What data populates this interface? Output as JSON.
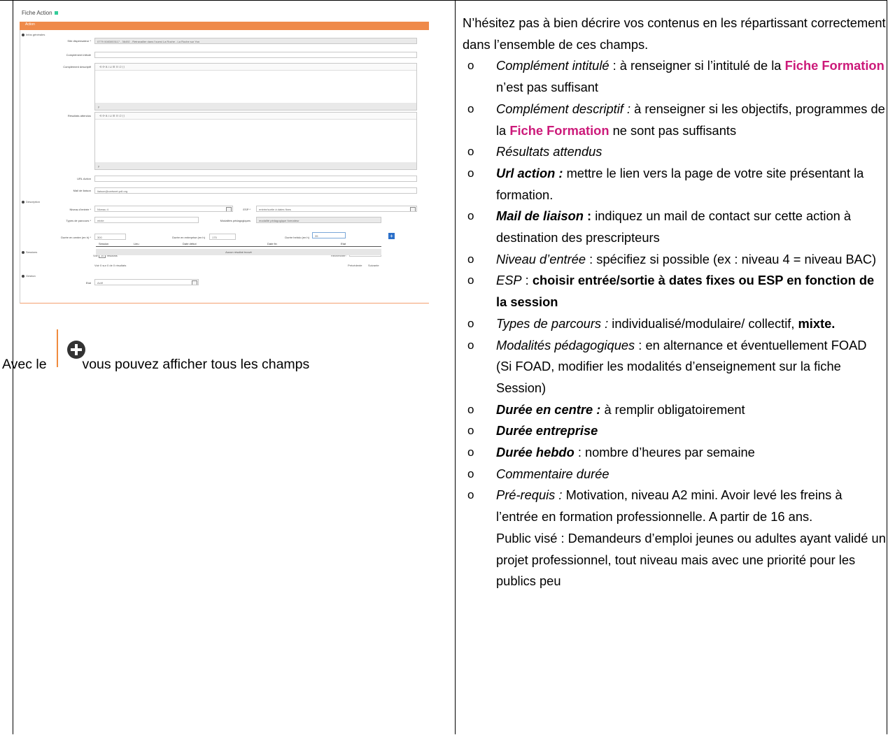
{
  "screenshot": {
    "title": "Fiche Action",
    "bar_label": "Action",
    "sections": {
      "infos": "Infos générales",
      "description": "Description",
      "sessions": "Sessions",
      "gestion": "Gestion"
    },
    "labels": {
      "site": "Site dispensateur *",
      "comp_intitule": "Complément intitulé",
      "comp_descriptif": "Complément descriptif",
      "resultats": "Résultats attendus",
      "url": "URL Action",
      "mail": "Mail de liaison",
      "niveau": "Niveau d'entrée *",
      "esp": "ESP *",
      "types": "Types de parcours *",
      "modalites": "Modalités pédagogiques",
      "duree_centre": "Durée en centre (en h) *",
      "duree_entreprise": "Durée en entreprise (en h)",
      "duree_hebdo": "Durée hebdo (en h)",
      "etat": "Etat",
      "voir": "Voir",
      "resultats_count": "résultats",
      "rechercher": "Rechercher:"
    },
    "values": {
      "site": "0779 0083003117 - 36492 - Retravailler dans l'ouest La Roche - La Roche sur Yon",
      "mail": "liaison@cartsnet-pdl.org",
      "niveau": "Niveau 4",
      "esp": "entrée/sortie à dates fixes",
      "types": "mixte",
      "modalites": "modalité pédagogique formateur",
      "duree_centre": "300",
      "duree_entreprise": "175",
      "duree_hebdo": "35",
      "etat": "Actif",
      "voir": "10",
      "editor_footer": "p"
    },
    "editor_toolbar": "⟲  ⟳   B  I  U   ☰  ☷   ∅   ⟨⟩",
    "table_cols": [
      "Session",
      "Lieu",
      "Date début",
      "Date fin",
      "Etat"
    ],
    "empty": "Aucun résultat trouvé",
    "footer_info": "Voir 0 sur 0 de 0 résultats",
    "prev": "Précédente",
    "next": "Suivante"
  },
  "caption": {
    "before": "Avec le",
    "after": "vous pouvez afficher tous les champs"
  },
  "right": {
    "intro": "N’hésitez pas à bien décrire vos contenus en les répartissant correctement dans l’ensemble de ces champs.",
    "i1_label": "Complément intitulé",
    "i1_text_a": " : à renseigner si l’intitulé de la ",
    "i1_fiche": "Fiche Formation",
    "i1_text_b": " n’est pas suffisant",
    "i2_label": "Complément descriptif :",
    "i2_text_a": " à renseigner si les objectifs, programmes de la ",
    "i2_fiche": "Fiche Formation",
    "i2_text_b": " ne sont pas suffisants",
    "i3_label": "Résultats attendus",
    "i4_label": "Url action :",
    "i4_text": "  mettre le lien vers la page de votre site présentant la formation.",
    "i5_label": "Mail de liaison",
    "i5_colon": " :",
    "i5_text": " indiquez un mail de contact sur cette action à destination des prescripteurs",
    "i6_label": "Niveau d’entrée",
    "i6_text": " : spécifiez si possible (ex : niveau 4 = niveau BAC)",
    "i7_label": "ESP",
    "i7_colon": " : ",
    "i7_text": "choisir entrée/sortie à dates fixes ou ESP en fonction de la session",
    "i8_label": "Types de parcours :",
    "i8_text": " individualisé/modulaire/ collectif, ",
    "i8_bold": "mixte.",
    "i9_label": "Modalités pédagogiques",
    "i9_text": " : en alternance et éventuellement FOAD",
    "i9_note": "(Si FOAD, modifier les modalités d’enseignement sur la fiche Session)",
    "i10_label": "Durée en centre :",
    "i10_text": " à remplir obligatoirement",
    "i11_label": "Durée entreprise",
    "i12_label": "Durée hebdo",
    "i12_text": " : nombre d’heures par semaine",
    "i13_label": "Commentaire durée",
    "i14_label": "Pré-requis :",
    "i14_text": " Motivation, niveau A2 mini. Avoir levé les freins à l’entrée en formation professionnelle. A partir de 16 ans.",
    "i14_public": "Public visé : Demandeurs d’emploi jeunes ou adultes ayant validé un projet professionnel, tout niveau mais avec une priorité pour les publics peu"
  }
}
